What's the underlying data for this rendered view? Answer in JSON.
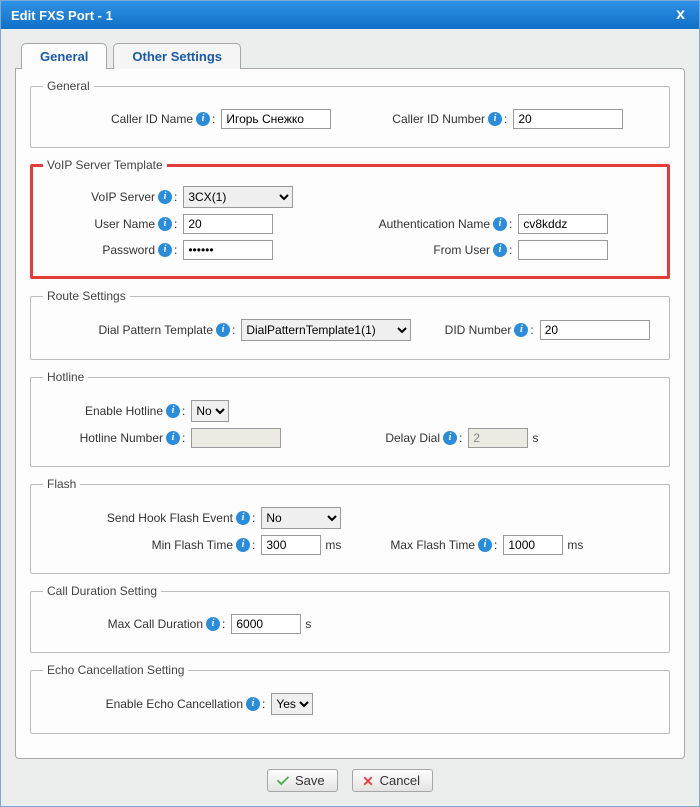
{
  "window": {
    "title": "Edit FXS Port - 1",
    "close": "x"
  },
  "tabs": {
    "general": "General",
    "other": "Other Settings"
  },
  "sections": {
    "general": {
      "legend": "General",
      "caller_id_name_label": "Caller ID Name",
      "caller_id_name_value": "Игорь Снежко",
      "caller_id_number_label": "Caller ID Number",
      "caller_id_number_value": "20"
    },
    "voip": {
      "legend": "VoIP Server Template",
      "voip_server_label": "VoIP Server",
      "voip_server_value": "3CX(1)",
      "user_name_label": "User Name",
      "user_name_value": "20",
      "auth_name_label": "Authentication Name",
      "auth_name_value": "cv8kddz",
      "password_label": "Password",
      "password_value": "••••••",
      "from_user_label": "From User",
      "from_user_value": ""
    },
    "route": {
      "legend": "Route Settings",
      "dial_pattern_label": "Dial Pattern Template",
      "dial_pattern_value": "DialPatternTemplate1(1)",
      "did_number_label": "DID Number",
      "did_number_value": "20"
    },
    "hotline": {
      "legend": "Hotline",
      "enable_label": "Enable Hotline",
      "enable_value": "No",
      "number_label": "Hotline Number",
      "number_value": "",
      "delay_label": "Delay Dial",
      "delay_value": "2",
      "delay_unit": "s"
    },
    "flash": {
      "legend": "Flash",
      "send_hook_label": "Send Hook Flash Event",
      "send_hook_value": "No",
      "min_label": "Min Flash Time",
      "min_value": "300",
      "max_label": "Max Flash Time",
      "max_value": "1000",
      "unit": "ms"
    },
    "duration": {
      "legend": "Call Duration Setting",
      "max_label": "Max Call Duration",
      "max_value": "6000",
      "unit": "s"
    },
    "echo": {
      "legend": "Echo Cancellation Setting",
      "enable_label": "Enable Echo Cancellation",
      "enable_value": "Yes"
    }
  },
  "buttons": {
    "save": "Save",
    "cancel": "Cancel"
  }
}
